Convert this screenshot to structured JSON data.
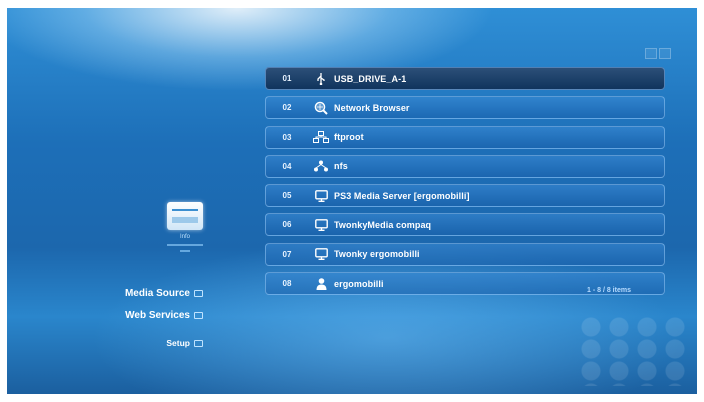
{
  "items": [
    {
      "num": "01",
      "icon": "usb-icon",
      "label": "USB_DRIVE_A-1"
    },
    {
      "num": "02",
      "icon": "network-browser-icon",
      "label": "Network Browser"
    },
    {
      "num": "03",
      "icon": "network-share-icon",
      "label": "ftproot"
    },
    {
      "num": "04",
      "icon": "nfs-icon",
      "label": "nfs"
    },
    {
      "num": "05",
      "icon": "media-server-icon",
      "label": "PS3 Media Server [ergomobilli]"
    },
    {
      "num": "06",
      "icon": "media-server-icon",
      "label": "TwonkyMedia compaq"
    },
    {
      "num": "07",
      "icon": "media-server-icon",
      "label": "Twonky ergomobilli"
    },
    {
      "num": "08",
      "icon": "user-icon",
      "label": "ergomobilli"
    }
  ],
  "selected_index": 0,
  "item_count_text": "1 - 8 / 8 items",
  "info": {
    "title": "Info"
  },
  "menu": {
    "media_source": "Media Source",
    "web_services": "Web Services",
    "setup": "Setup"
  },
  "colors": {
    "background": "#1d6fb8",
    "selected_row": "#10345d",
    "row_border": "#aad7ff"
  }
}
